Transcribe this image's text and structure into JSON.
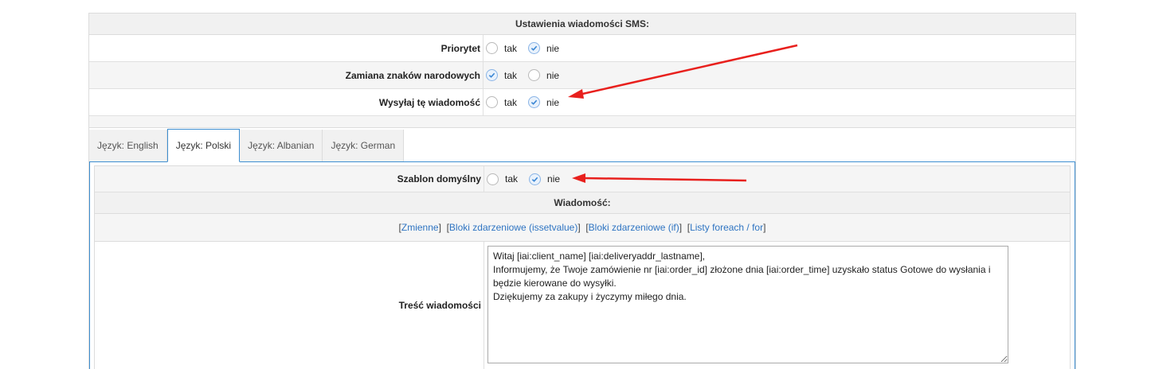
{
  "sms_settings": {
    "header": "Ustawienia wiadomości SMS:",
    "rows": [
      {
        "label": "Priorytet",
        "yes": "tak",
        "no": "nie",
        "selected": "nie"
      },
      {
        "label": "Zamiana znaków narodowych",
        "yes": "tak",
        "no": "nie",
        "selected": "tak"
      },
      {
        "label": "Wysyłaj tę wiadomość",
        "yes": "tak",
        "no": "nie",
        "selected": "nie"
      }
    ]
  },
  "tabs": [
    {
      "label": "Język: English",
      "active": false
    },
    {
      "label": "Język: Polski",
      "active": true
    },
    {
      "label": "Język: Albanian",
      "active": false
    },
    {
      "label": "Język: German",
      "active": false
    }
  ],
  "template": {
    "default_label": "Szablon domyślny",
    "yes": "tak",
    "no": "nie",
    "selected": "nie",
    "message_header": "Wiadomość:",
    "variable_links": {
      "variables": "Zmienne",
      "event_blocks_issetvalue": "Bloki zdarzeniowe (issetvalue)",
      "event_blocks_if": "Bloki zdarzeniowe (if)",
      "foreach_lists": "Listy foreach / for"
    },
    "content_label": "Treść wiadomości",
    "content_value": "Witaj [iai:client_name] [iai:deliveryaddr_lastname],\nInformujemy, że Twoje zamówienie nr [iai:order_id] złożone dnia [iai:order_time] uzyskało status Gotowe do wysłania i będzie kierowane do wysyłki.\nDziękujemy za zakupy i życzymy miłego dnia."
  },
  "colors": {
    "accent": "#3d8ed0",
    "link": "#2e74c2",
    "annotation_arrow": "#e8201d"
  }
}
